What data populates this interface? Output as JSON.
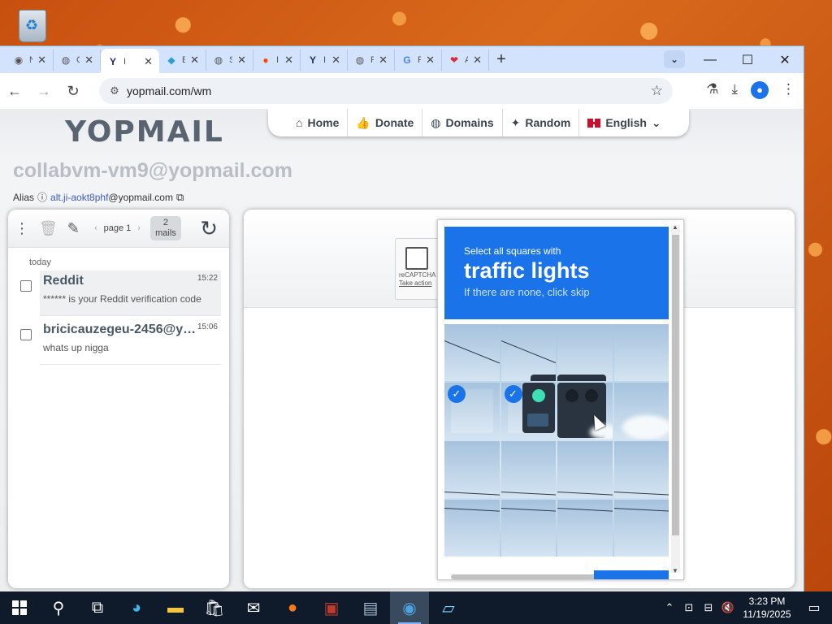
{
  "browser": {
    "tabs": [
      {
        "icon": "chrome-icon",
        "glyph": "◉",
        "title": "N"
      },
      {
        "icon": "globe-icon",
        "glyph": "◍",
        "title": "C"
      },
      {
        "icon": "yopmail-icon",
        "glyph": "Y",
        "title": "I",
        "active": true
      },
      {
        "icon": "cube-icon",
        "glyph": "◆",
        "title": "E"
      },
      {
        "icon": "globe-icon",
        "glyph": "◍",
        "title": "S"
      },
      {
        "icon": "reddit-icon",
        "glyph": "●",
        "title": "I"
      },
      {
        "icon": "yopmail-icon",
        "glyph": "Y",
        "title": "I"
      },
      {
        "icon": "globe-icon",
        "glyph": "◍",
        "title": "F"
      },
      {
        "icon": "google-icon",
        "glyph": "G",
        "title": "F"
      },
      {
        "icon": "heart-icon",
        "glyph": "❤",
        "title": "A"
      }
    ],
    "url": "yopmail.com/wm"
  },
  "yopmail": {
    "logo": "YOPMAIL",
    "nav": {
      "home": "Home",
      "donate": "Donate",
      "domains": "Domains",
      "random": "Random",
      "language": "English"
    },
    "address": "collabvm-vm9@yopmail.com",
    "alias_label": "Alias",
    "alias_value": "alt.ji-aokt8phf",
    "alias_domain": "@yopmail.com",
    "inbox": {
      "page_label": "page 1",
      "mail_count": "2",
      "mail_count_label": "mails",
      "day_label": "today",
      "mails": [
        {
          "from": "Reddit",
          "subject": "****** is your Reddit verification code",
          "time": "15:22"
        },
        {
          "from": "bricicauzegeu-2456@yopmail.com",
          "subject": "whats up nigga",
          "time": "15:06"
        }
      ]
    }
  },
  "recaptcha": {
    "checkbox_label": "reCAPTCHA",
    "link_label": "Take action",
    "instruction_line1": "Select all squares with",
    "target": "traffic lights",
    "instruction_line3": "If there are none, click skip",
    "selected_tiles": [
      4,
      5
    ]
  },
  "taskbar": {
    "time": "3:23 PM",
    "date": "11/19/2025"
  }
}
